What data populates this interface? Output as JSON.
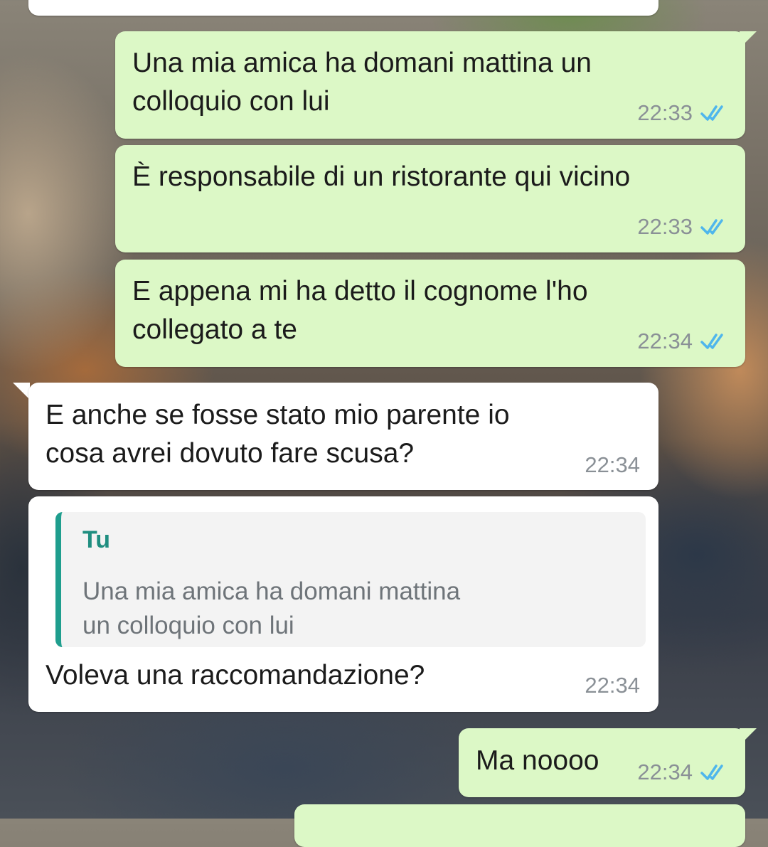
{
  "messages": [
    {
      "direction": "outgoing",
      "text": "Una mia amica ha domani mattina un\ncolloquio con lui",
      "time": "22:33",
      "status": "read"
    },
    {
      "direction": "outgoing",
      "text": "È responsabile di un ristorante qui vicino",
      "time": "22:33",
      "status": "read"
    },
    {
      "direction": "outgoing",
      "text": "E appena mi ha detto il cognome l'ho\ncollegato a te",
      "time": "22:34",
      "status": "read"
    },
    {
      "direction": "incoming",
      "text": "E anche se fosse stato mio parente io\ncosa avrei dovuto fare scusa?",
      "time": "22:34"
    },
    {
      "direction": "incoming",
      "quote": {
        "author": "Tu",
        "text": "Una mia amica ha domani mattina\nun colloquio con lui"
      },
      "text": "Voleva una raccomandazione?",
      "time": "22:34"
    },
    {
      "direction": "outgoing",
      "text": "Ma noooo",
      "time": "22:34",
      "status": "read"
    }
  ],
  "colors": {
    "outgoing_bubble": "#dcf8c6",
    "incoming_bubble": "#ffffff",
    "read_ticks": "#4fb6ec",
    "quote_accent": "#1f9e8e"
  },
  "icons": {
    "read_status": "double-check-icon"
  }
}
